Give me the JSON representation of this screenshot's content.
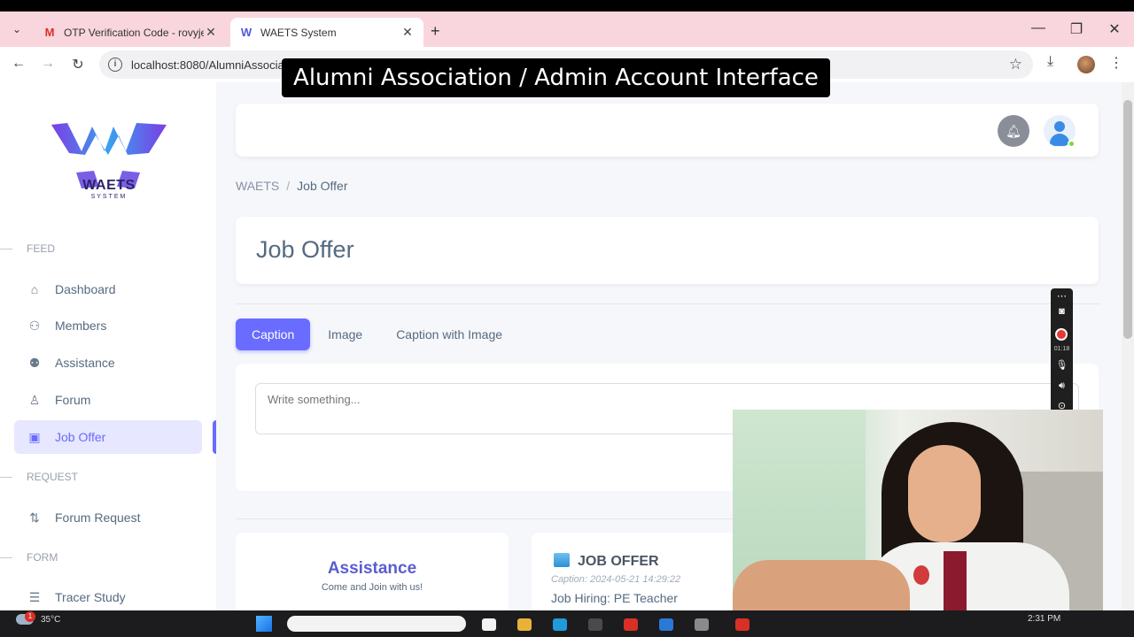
{
  "browser": {
    "tabs": [
      {
        "title": "OTP Verification Code - rovyjen",
        "favicon": "gmail-icon",
        "active": false
      },
      {
        "title": "WAETS System",
        "favicon": "waets-icon",
        "active": true
      }
    ],
    "favicon_letters": {
      "gmail": "M",
      "waets": "W"
    },
    "url": "localhost:8080/AlumniAssocia",
    "colors": {
      "tabbar": "#f9d6dd",
      "accent": "#696cff"
    }
  },
  "caption_overlay": "Alumni Association / Admin Account Interface",
  "logo": {
    "name": "WAETS",
    "sub": "SYSTEM"
  },
  "sidebar": {
    "sections": {
      "feed": "FEED",
      "request": "REQUEST",
      "form": "FORM"
    },
    "items": [
      {
        "label": "Dashboard",
        "icon": "home-icon"
      },
      {
        "label": "Members",
        "icon": "user-icon"
      },
      {
        "label": "Assistance",
        "icon": "assist-icon"
      },
      {
        "label": "Forum",
        "icon": "group-icon"
      },
      {
        "label": "Job Offer",
        "icon": "briefcase-icon",
        "active": true
      },
      {
        "label": "Forum Request",
        "icon": "pull-request-icon"
      },
      {
        "label": "Tracer Study",
        "icon": "chart-icon"
      }
    ]
  },
  "breadcrumb": {
    "root": "WAETS",
    "separator": "/",
    "current": "Job Offer"
  },
  "page_title": "Job Offer",
  "post_tabs": [
    {
      "label": "Caption",
      "active": true
    },
    {
      "label": "Image",
      "active": false
    },
    {
      "label": "Caption with Image",
      "active": false
    }
  ],
  "composer": {
    "placeholder": "Write something..."
  },
  "cards": {
    "assistance": {
      "title": "Assistance",
      "subtitle": "Come and Join with us!"
    },
    "job_offer": {
      "title": "JOB OFFER",
      "caption": "Caption: 2024-05-21 14:29:22",
      "text": "Job Hiring: PE Teacher"
    }
  },
  "recorder": {
    "time": "01:18"
  },
  "taskbar": {
    "temperature": "35°C",
    "notification_count": "1",
    "clock": "2:31 PM"
  }
}
